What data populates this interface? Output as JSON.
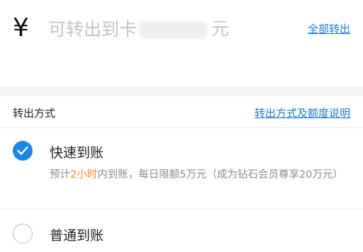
{
  "amount": {
    "currency_symbol": "¥",
    "placeholder": "可转出到卡",
    "placeholder_suffix": "元",
    "withdraw_all_label": "全部转出"
  },
  "method_section": {
    "title": "转出方式",
    "info_link": "转出方式及额度说明"
  },
  "options": [
    {
      "label": "快速到账",
      "selected": true,
      "desc_prefix": "预计",
      "desc_highlight": "2小时",
      "desc_suffix": "内到账，每日限额5万元（成为钻石会员尊享20万元）",
      "highlight_color": "#f7861f"
    },
    {
      "label": "普通到账",
      "selected": false
    }
  ],
  "colors": {
    "accent": "#1b86e8",
    "link": "#1a7ad6"
  }
}
